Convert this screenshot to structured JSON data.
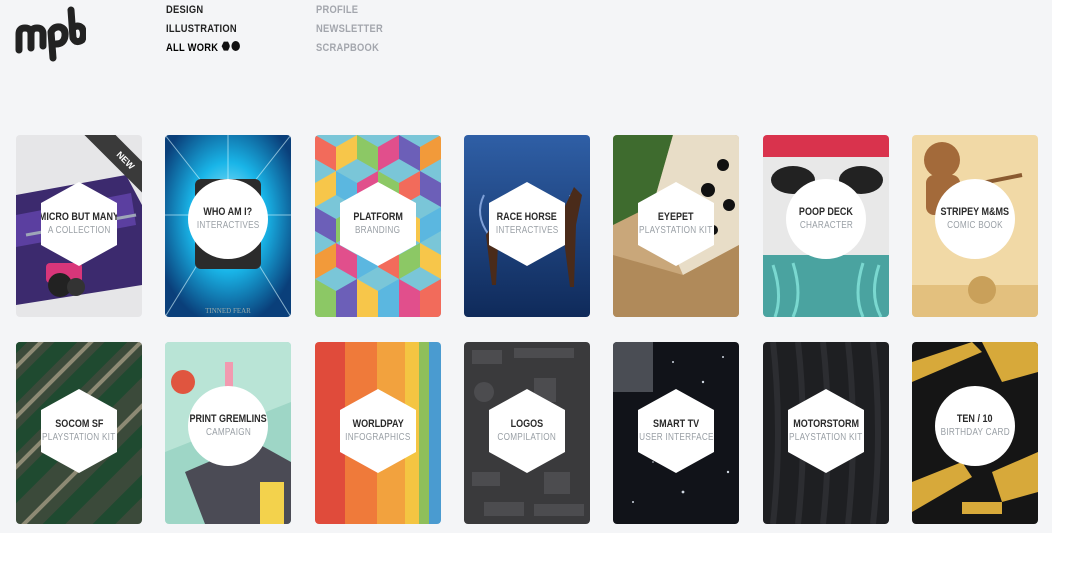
{
  "brand": {
    "logo_text": "mpb"
  },
  "nav": {
    "primary": [
      {
        "label": "DESIGN"
      },
      {
        "label": "ILLUSTRATION"
      },
      {
        "label": "ALL WORK"
      }
    ],
    "secondary": [
      {
        "label": "PROFILE"
      },
      {
        "label": "NEWSLETTER"
      },
      {
        "label": "SCRAPBOOK"
      }
    ]
  },
  "projects": [
    {
      "title": "MICRO BUT MANY",
      "subtitle": "A COLLECTION",
      "badge": "NEW",
      "art_text": "",
      "badge_shape": "hexagon"
    },
    {
      "title": "WHO AM I?",
      "subtitle": "INTERACTIVES",
      "art_text": "TINNED FEAR",
      "badge_shape": "circle"
    },
    {
      "title": "PLATFORM",
      "subtitle": "BRANDING",
      "art_text": "",
      "badge_shape": "hexagon"
    },
    {
      "title": "RACE HORSE",
      "subtitle": "INTERACTIVES",
      "art_text": "",
      "badge_shape": "hexagon"
    },
    {
      "title": "EYEPET",
      "subtitle": "PLAYSTATION KIT",
      "art_text": "",
      "badge_shape": "hexagon"
    },
    {
      "title": "POOP DECK",
      "subtitle": "CHARACTER",
      "art_text": "",
      "badge_shape": "circle"
    },
    {
      "title": "STRIPEY M&MS",
      "subtitle": "COMIC BOOK",
      "art_text": "",
      "badge_shape": "circle"
    },
    {
      "title": "SOCOM SF",
      "subtitle": "PLAYSTATION KIT",
      "art_text": "",
      "badge_shape": "hexagon"
    },
    {
      "title": "PRINT GREMLINS",
      "subtitle": "CAMPAIGN",
      "art_text": "",
      "badge_shape": "circle"
    },
    {
      "title": "WORLDPAY",
      "subtitle": "INFOGRAPHICS",
      "art_text": "",
      "badge_shape": "hexagon"
    },
    {
      "title": "LOGOS",
      "subtitle": "COMPILATION",
      "art_text": "",
      "badge_shape": "hexagon"
    },
    {
      "title": "SMART TV",
      "subtitle": "USER INTERFACE",
      "art_text": "",
      "badge_shape": "hexagon"
    },
    {
      "title": "MOTORSTORM",
      "subtitle": "PLAYSTATION KIT",
      "art_text": "",
      "badge_shape": "hexagon"
    },
    {
      "title": "TEN / 10",
      "subtitle": "BIRTHDAY CARD",
      "art_text": "",
      "badge_shape": "circle"
    }
  ],
  "colors": {
    "page_bg": "#f4f5f7",
    "nav_active": "#000000",
    "nav_muted": "#a3a6ad"
  }
}
